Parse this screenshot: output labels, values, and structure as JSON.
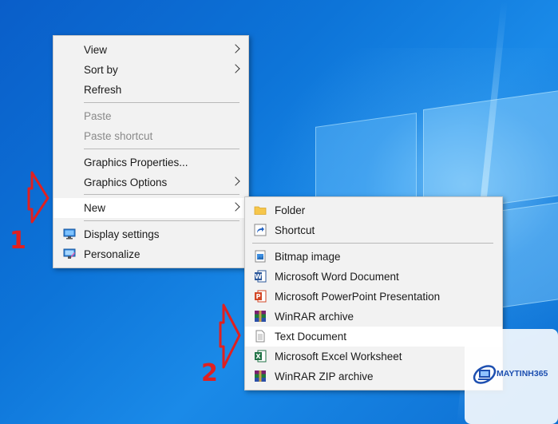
{
  "context_menu": {
    "items": [
      {
        "label": "View",
        "has_submenu": true
      },
      {
        "label": "Sort by",
        "has_submenu": true
      },
      {
        "label": "Refresh"
      },
      {
        "label": "Paste",
        "disabled": true
      },
      {
        "label": "Paste shortcut",
        "disabled": true
      },
      {
        "label": "Graphics Properties..."
      },
      {
        "label": "Graphics Options",
        "has_submenu": true
      },
      {
        "label": "New",
        "has_submenu": true,
        "highlighted": true
      },
      {
        "label": "Display settings",
        "icon": "display-settings-icon"
      },
      {
        "label": "Personalize",
        "icon": "personalize-icon"
      }
    ]
  },
  "new_submenu": {
    "items": [
      {
        "label": "Folder",
        "icon": "folder-icon"
      },
      {
        "label": "Shortcut",
        "icon": "shortcut-icon"
      },
      {
        "label": "Bitmap image",
        "icon": "bitmap-icon"
      },
      {
        "label": "Microsoft Word Document",
        "icon": "word-icon"
      },
      {
        "label": "Microsoft PowerPoint Presentation",
        "icon": "powerpoint-icon"
      },
      {
        "label": "WinRAR archive",
        "icon": "winrar-icon"
      },
      {
        "label": "Text Document",
        "icon": "text-document-icon",
        "highlighted": true
      },
      {
        "label": "Microsoft Excel Worksheet",
        "icon": "excel-icon"
      },
      {
        "label": "WinRAR ZIP archive",
        "icon": "winrar-zip-icon"
      }
    ]
  },
  "annotations": {
    "step1": "1",
    "step2": "2",
    "color": "#e02020"
  },
  "watermark": {
    "brand": "MAYTINH365"
  }
}
